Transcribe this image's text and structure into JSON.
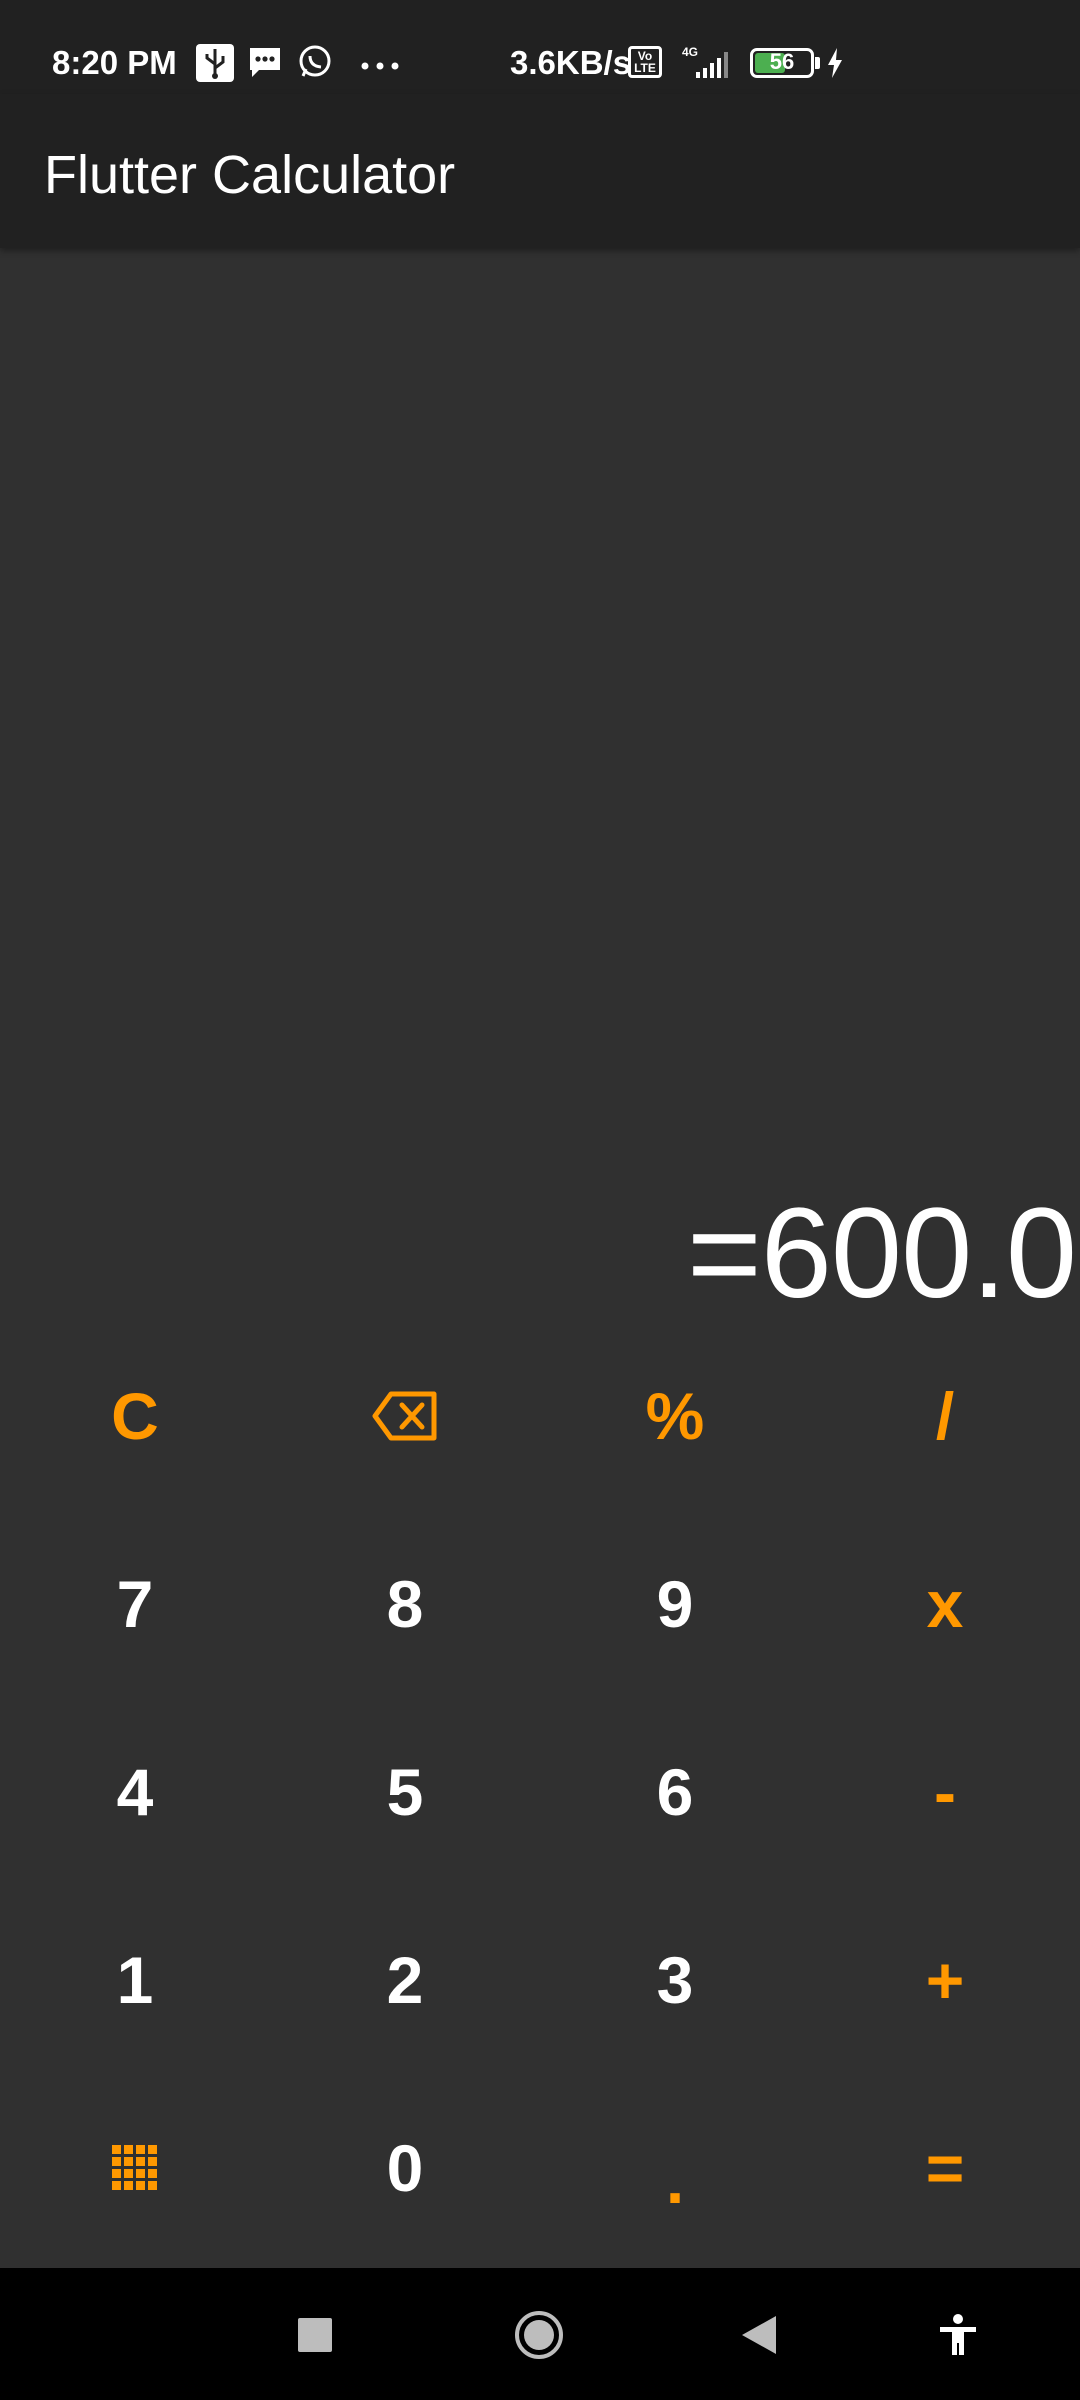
{
  "status_bar": {
    "time": "8:20 PM",
    "network_speed": "3.6KB/s",
    "volte_label": "Vo LTE",
    "network_type": "4G",
    "battery_level": "56",
    "battery_fraction": 0.56,
    "icons": [
      "usb-icon",
      "message-icon",
      "whatsapp-icon",
      "more-dots-icon",
      "signal-icon",
      "charging-bolt-icon"
    ]
  },
  "app_bar": {
    "title": "Flutter Calculator"
  },
  "display": {
    "result": "=600.0"
  },
  "keypad": {
    "rows": [
      [
        "C",
        "backspace",
        "%",
        "/"
      ],
      [
        "7",
        "8",
        "9",
        "x"
      ],
      [
        "4",
        "5",
        "6",
        "-"
      ],
      [
        "1",
        "2",
        "3",
        "+"
      ],
      [
        "grid",
        "0",
        ".",
        "="
      ]
    ],
    "labels": {
      "clear": "C",
      "percent": "%",
      "divide": "/",
      "seven": "7",
      "eight": "8",
      "nine": "9",
      "multiply": "x",
      "four": "4",
      "five": "5",
      "six": "6",
      "minus": "-",
      "one": "1",
      "two": "2",
      "three": "3",
      "plus": "+",
      "zero": "0",
      "decimal": ".",
      "equals": "="
    }
  },
  "colors": {
    "accent": "#ff9800",
    "background": "#303030",
    "app_bar": "#212121",
    "text": "#ffffff"
  },
  "nav_bar": {
    "icons": [
      "recents-square-icon",
      "home-circle-icon",
      "back-triangle-icon",
      "accessibility-icon"
    ]
  }
}
